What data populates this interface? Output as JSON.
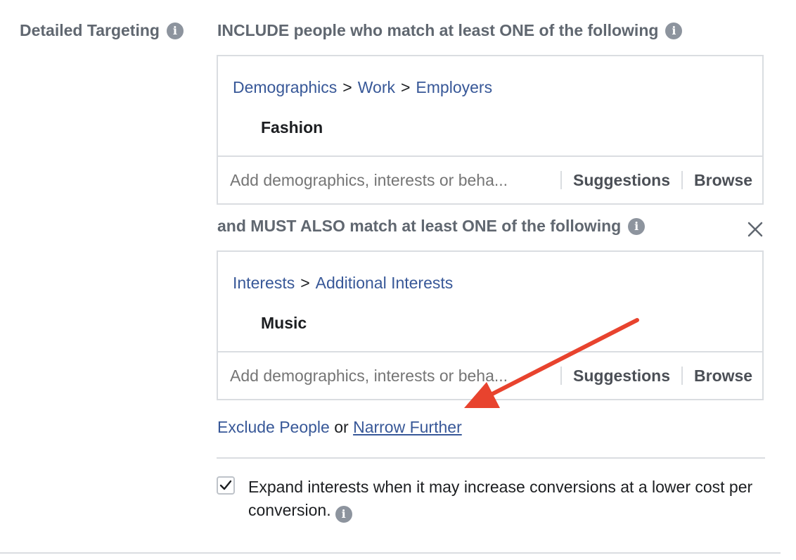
{
  "section_label": "Detailed Targeting",
  "include_header": "INCLUDE people who match at least ONE of the following",
  "include_group": {
    "breadcrumb": [
      "Demographics",
      "Work",
      "Employers"
    ],
    "breadcrumb_separator": ">",
    "item": "Fashion",
    "input_placeholder": "Add demographics, interests or beha...",
    "suggestions_label": "Suggestions",
    "browse_label": "Browse"
  },
  "must_also_header": "and MUST ALSO match at least ONE of the following",
  "must_also_group": {
    "breadcrumb": [
      "Interests",
      "Additional Interests"
    ],
    "breadcrumb_separator": ">",
    "item": "Music",
    "input_placeholder": "Add demographics, interests or beha...",
    "suggestions_label": "Suggestions",
    "browse_label": "Browse"
  },
  "actions": {
    "exclude_label": "Exclude People",
    "or_text": "or",
    "narrow_label": "Narrow Further"
  },
  "expand_interests": {
    "checked": true,
    "text": "Expand interests when it may increase conversions at a lower cost per conversion."
  },
  "colors": {
    "link": "#385898",
    "label_gray": "#606770",
    "border": "#dadde1",
    "annotation_arrow": "#e8432e"
  },
  "icons": [
    "info-icon",
    "close-icon",
    "checkmark-icon",
    "annotation-arrow"
  ]
}
